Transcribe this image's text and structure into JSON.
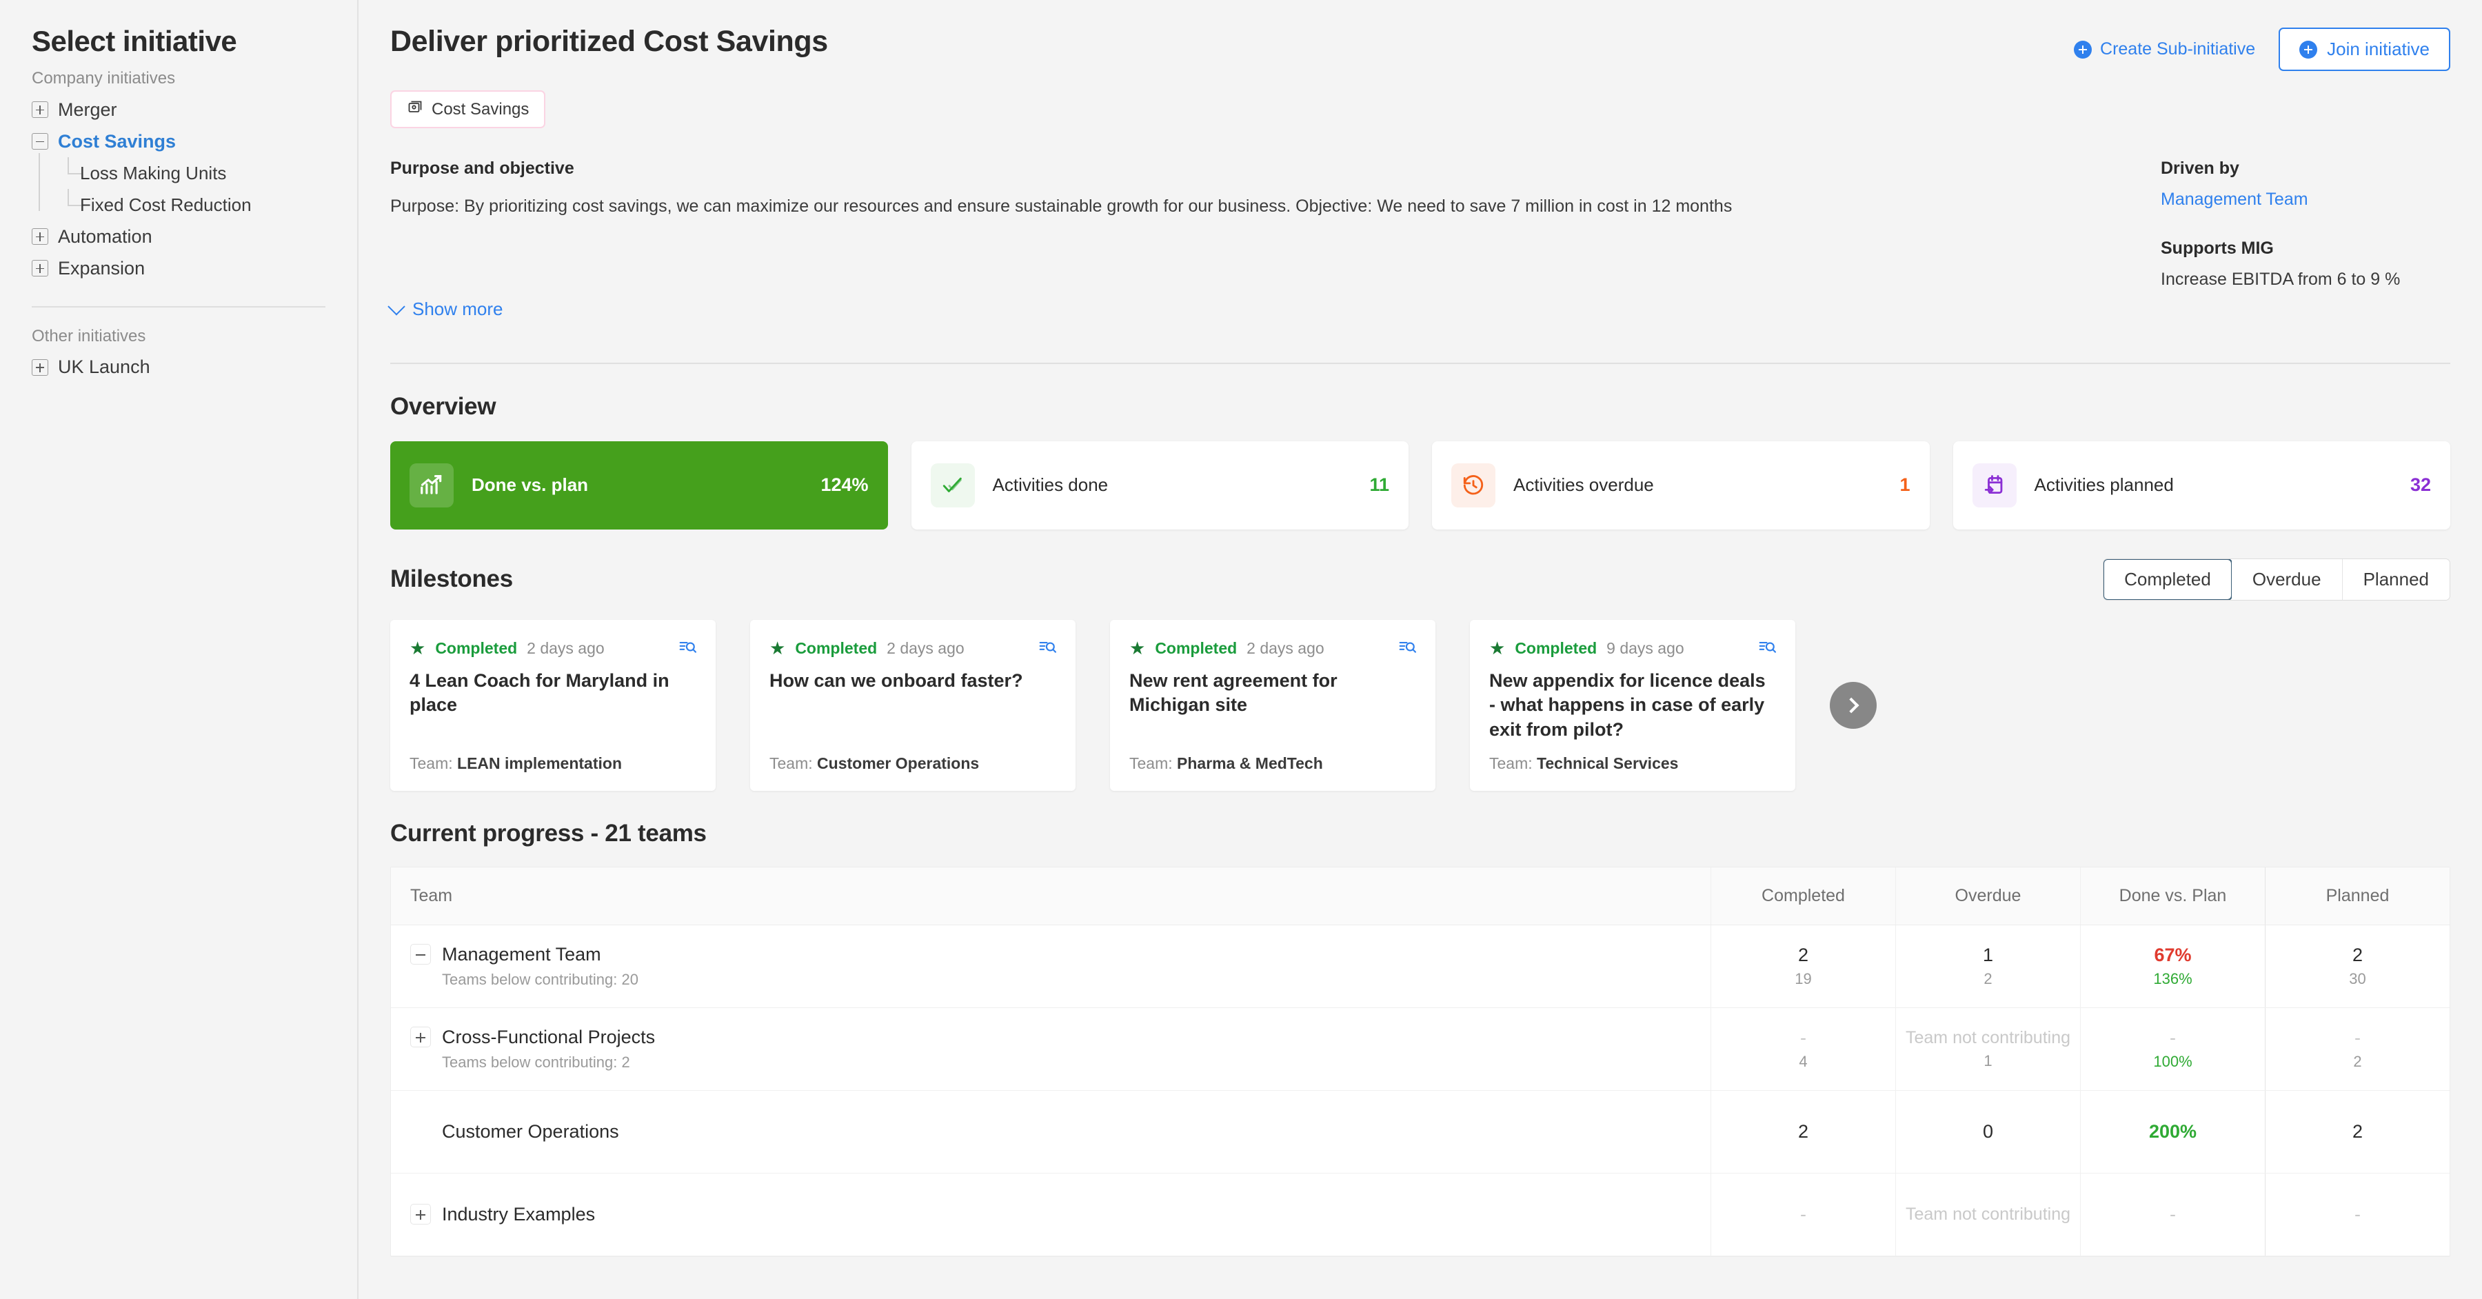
{
  "sidebar": {
    "title": "Select initiative",
    "company_label": "Company initiatives",
    "other_label": "Other initiatives",
    "items": [
      {
        "label": "Merger",
        "toggle": "plus"
      },
      {
        "label": "Cost Savings",
        "toggle": "minus",
        "active": true
      },
      {
        "label": "Automation",
        "toggle": "plus"
      },
      {
        "label": "Expansion",
        "toggle": "plus"
      }
    ],
    "children": [
      {
        "label": "Loss Making Units"
      },
      {
        "label": "Fixed Cost Reduction"
      }
    ],
    "other_items": [
      {
        "label": "UK Launch",
        "toggle": "plus"
      }
    ]
  },
  "header": {
    "title": "Deliver prioritized Cost Savings",
    "chip_label": "Cost Savings",
    "chip_icon": "initiative-icon",
    "create_sub_label": "Create Sub-initiative",
    "join_label": "Join initiative"
  },
  "purpose": {
    "heading": "Purpose and objective",
    "body": "Purpose: By prioritizing cost savings, we can maximize our resources and ensure sustainable growth for our business. Objective: We need to save 7 million in cost in 12 months",
    "show_more": "Show more",
    "driven_by_label": "Driven by",
    "driven_by_value": "Management Team",
    "supports_mig_label": "Supports MIG",
    "supports_mig_value": "Increase EBITDA from 6 to 9 %"
  },
  "overview": {
    "title": "Overview",
    "cards": [
      {
        "label": "Done vs. plan",
        "value": "124%",
        "icon": "chart-growth-icon",
        "accent": true,
        "color": "#45a01c"
      },
      {
        "label": "Activities done",
        "value": "11",
        "icon": "check-double-icon",
        "color": "#2faa34",
        "icon_bg": "#eff8ef"
      },
      {
        "label": "Activities overdue",
        "value": "1",
        "icon": "clock-rewind-icon",
        "color": "#f4611a",
        "icon_bg": "#fdefe9"
      },
      {
        "label": "Activities planned",
        "value": "32",
        "icon": "calendar-arrow-icon",
        "color": "#8b2fd4",
        "icon_bg": "#f6effc"
      }
    ]
  },
  "milestones": {
    "title": "Milestones",
    "filters": [
      {
        "label": "Completed",
        "active": true
      },
      {
        "label": "Overdue",
        "active": false
      },
      {
        "label": "Planned",
        "active": false
      }
    ],
    "team_prefix": "Team: ",
    "cards": [
      {
        "status": "Completed",
        "age": "2 days ago",
        "title": "4 Lean Coach for Maryland in place",
        "team": "LEAN implementation"
      },
      {
        "status": "Completed",
        "age": "2 days ago",
        "title": "How can we onboard faster?",
        "team": "Customer Operations"
      },
      {
        "status": "Completed",
        "age": "2 days ago",
        "title": "New rent agreement for Michigan site",
        "team": "Pharma & MedTech"
      },
      {
        "status": "Completed",
        "age": "9 days ago",
        "title": "New appendix for licence deals - what happens in case of early exit from pilot?",
        "team": "Technical Services"
      }
    ]
  },
  "progress": {
    "title": "Current progress - 21 teams",
    "columns": [
      "Team",
      "Completed",
      "Overdue",
      "Done vs. Plan",
      "Planned"
    ],
    "rows": [
      {
        "team": "Management Team",
        "sub": "Teams below contributing: 20",
        "toggle": "minus",
        "indent": 0,
        "completed": {
          "main": "2",
          "sub": "19"
        },
        "overdue": {
          "main": "1",
          "sub": "2"
        },
        "done_vs_plan": {
          "main": "67%",
          "main_color": "red",
          "sub": "136%",
          "sub_color": "green"
        },
        "planned": {
          "main": "2",
          "sub": "30"
        }
      },
      {
        "team": "Cross-Functional Projects",
        "sub": "Teams below contributing: 2",
        "toggle": "plus",
        "indent": 1,
        "completed": {
          "main": "-",
          "main_muted": true,
          "sub": "4"
        },
        "overdue": {
          "main": "Team not contributing",
          "main_muted": true,
          "sub": "1"
        },
        "done_vs_plan": {
          "main": "-",
          "main_muted": true,
          "sub": "100%",
          "sub_color": "green"
        },
        "planned": {
          "main": "-",
          "main_muted": true,
          "sub": "2"
        }
      },
      {
        "team": "Customer Operations",
        "sub": "",
        "toggle": "none",
        "indent": 1,
        "completed": {
          "main": "2",
          "sub": ""
        },
        "overdue": {
          "main": "0",
          "sub": ""
        },
        "done_vs_plan": {
          "main": "200%",
          "main_color": "green",
          "sub": ""
        },
        "planned": {
          "main": "2",
          "sub": ""
        }
      },
      {
        "team": "Industry Examples",
        "sub": "",
        "toggle": "plus",
        "indent": 1,
        "completed": {
          "main": "-",
          "main_muted": true,
          "sub": ""
        },
        "overdue": {
          "main": "Team not contributing",
          "main_muted": true,
          "sub": ""
        },
        "done_vs_plan": {
          "main": "-",
          "main_muted": true,
          "sub": ""
        },
        "planned": {
          "main": "-",
          "main_muted": true,
          "sub": ""
        }
      }
    ]
  }
}
